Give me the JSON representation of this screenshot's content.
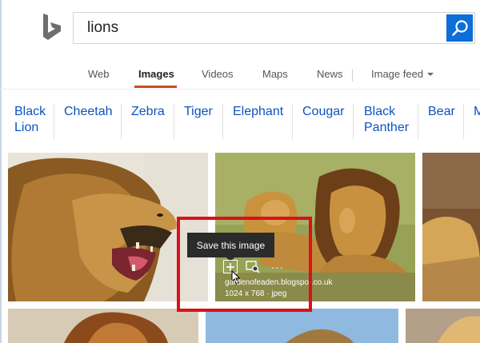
{
  "search": {
    "query": "lions"
  },
  "nav": {
    "items": [
      {
        "label": "Web"
      },
      {
        "label": "Images"
      },
      {
        "label": "Videos"
      },
      {
        "label": "Maps"
      },
      {
        "label": "News"
      }
    ],
    "feed_label": "Image feed",
    "accent": "#c8501e"
  },
  "related": [
    {
      "line1": "Black",
      "line2": "Lion"
    },
    {
      "line1": "Cheetah",
      "line2": ""
    },
    {
      "line1": "Zebra",
      "line2": ""
    },
    {
      "line1": "Tiger",
      "line2": ""
    },
    {
      "line1": "Elephant",
      "line2": ""
    },
    {
      "line1": "Cougar",
      "line2": ""
    },
    {
      "line1": "Black",
      "line2": "Panther"
    },
    {
      "line1": "Bear",
      "line2": ""
    },
    {
      "line1": "M",
      "line2": ""
    }
  ],
  "hover": {
    "tooltip": "Save this image",
    "domain": "gardenofeaden.blogspot.co.uk",
    "meta": "1024 x 768 · jpeg",
    "highlight_color": "#d9111b"
  },
  "colors": {
    "link": "#0b53c1",
    "brand": "#0c6ed8"
  }
}
